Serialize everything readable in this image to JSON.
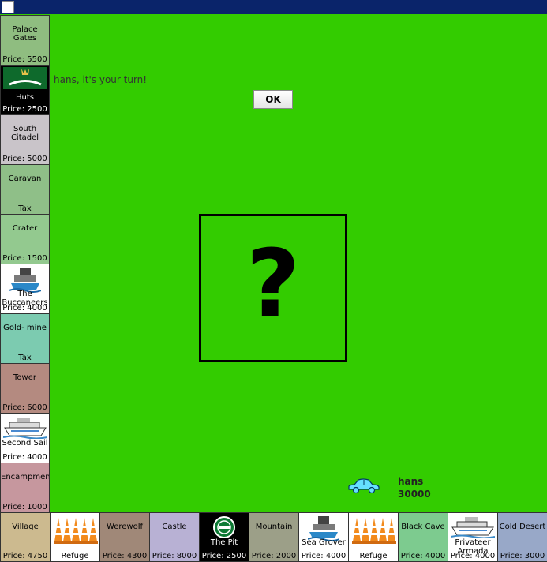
{
  "message": "hans, it's your turn!",
  "ok_label": "OK",
  "question": "?",
  "player": {
    "name": "hans",
    "money": "30000"
  },
  "left_column": [
    {
      "name": "Palace Gates",
      "foot": "Price: 5500",
      "color": "#8fbd80",
      "dark": false,
      "icon": ""
    },
    {
      "name": "Huts",
      "foot": "Price: 2500",
      "color": "#000000",
      "dark": true,
      "icon": "carlsberg-logo-icon"
    },
    {
      "name": "South Citadel",
      "foot": "Price: 5000",
      "color": "#c9c4c9",
      "dark": false,
      "icon": ""
    },
    {
      "name": "Caravan",
      "foot": "Tax",
      "color": "#8fbf88",
      "dark": false,
      "icon": ""
    },
    {
      "name": "Crater",
      "foot": "Price: 1500",
      "color": "#93c98f",
      "dark": false,
      "icon": ""
    },
    {
      "name": "The Buccaneers",
      "foot": "Price: 4000",
      "color": "#ffffff",
      "dark": false,
      "icon": "ship-logo-icon"
    },
    {
      "name": "Gold- mine",
      "foot": "Tax",
      "color": "#7ccbb0",
      "dark": false,
      "icon": ""
    },
    {
      "name": "Tower",
      "foot": "Price: 6000",
      "color": "#b48a80",
      "dark": false,
      "icon": ""
    },
    {
      "name": "Second Sail",
      "foot": "Price: 4000",
      "color": "#ffffff",
      "dark": false,
      "icon": "ferry-icon"
    },
    {
      "name": "Encampment",
      "foot": "Price: 1000",
      "color": "#c6979e",
      "dark": false,
      "icon": ""
    }
  ],
  "bottom_row": [
    {
      "name": "Village",
      "foot": "Price: 4750",
      "color": "#ccba8f",
      "dark": false,
      "icon": ""
    },
    {
      "name": "",
      "foot": "Refuge",
      "color": "#ffffff",
      "dark": false,
      "icon": "traffic-cones-icon"
    },
    {
      "name": "Werewolf",
      "foot": "Price: 4300",
      "color": "#a08878",
      "dark": false,
      "icon": ""
    },
    {
      "name": "Castle",
      "foot": "Price: 8000",
      "color": "#b8b1d4",
      "dark": false,
      "icon": ""
    },
    {
      "name": "The Pit",
      "foot": "Price: 2500",
      "color": "#000000",
      "dark": true,
      "icon": "tuborg-logo-icon"
    },
    {
      "name": "Mountain",
      "foot": "Price: 2000",
      "color": "#9c9f88",
      "dark": false,
      "icon": ""
    },
    {
      "name": "Sea Grover",
      "foot": "Price: 4000",
      "color": "#ffffff",
      "dark": false,
      "icon": "ship-logo-icon"
    },
    {
      "name": "",
      "foot": "Refuge",
      "color": "#ffffff",
      "dark": false,
      "icon": "traffic-cones-icon"
    },
    {
      "name": "Black Cave",
      "foot": "Price: 4000",
      "color": "#7dcb8f",
      "dark": false,
      "icon": ""
    },
    {
      "name": "Privateer Armada",
      "foot": "Price: 4000",
      "color": "#ffffff",
      "dark": false,
      "icon": "ferry-icon"
    },
    {
      "name": "Cold Desert",
      "foot": "Price: 3000",
      "color": "#98a8c8",
      "dark": false,
      "icon": ""
    }
  ]
}
